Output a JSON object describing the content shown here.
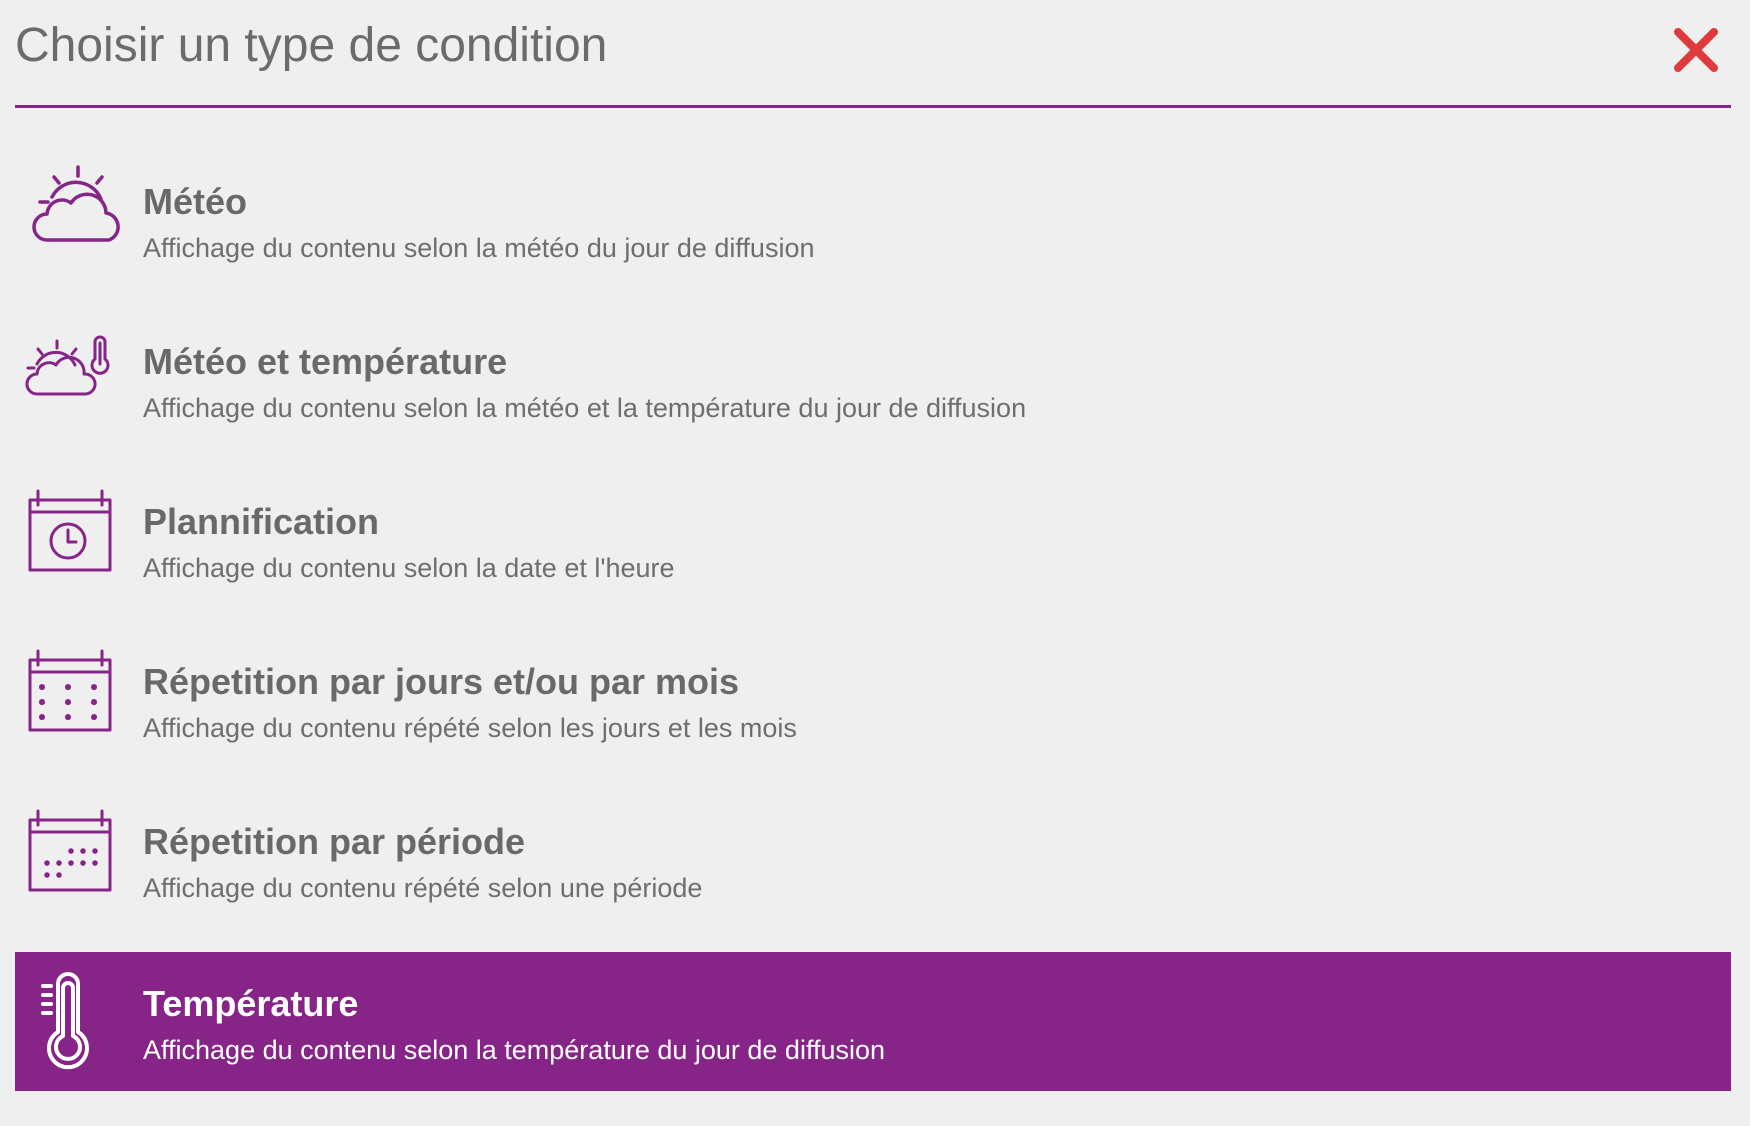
{
  "dialog": {
    "title": "Choisir un type de condition",
    "close_label": "Fermer",
    "accent_color": "#862488",
    "close_color": "#e03a3e"
  },
  "conditions": [
    {
      "name": "Météo",
      "description": "Affichage du contenu selon la météo du jour de diffusion",
      "icon": "weather-icon",
      "selected": false
    },
    {
      "name": "Météo et température",
      "description": "Affichage du contenu selon la météo et la température du jour de diffusion",
      "icon": "weather-thermometer-icon",
      "selected": false
    },
    {
      "name": "Plannification",
      "description": "Affichage du contenu selon la date et l'heure",
      "icon": "calendar-clock-icon",
      "selected": false
    },
    {
      "name": "Répetition par jours et/ou par mois",
      "description": "Affichage du contenu répété selon les jours et les mois",
      "icon": "calendar-grid-icon",
      "selected": false
    },
    {
      "name": "Répetition par période",
      "description": "Affichage du contenu répété selon une période",
      "icon": "calendar-period-icon",
      "selected": false
    },
    {
      "name": "Température",
      "description": "Affichage du contenu selon la température du jour de diffusion",
      "icon": "thermometer-icon",
      "selected": true
    }
  ]
}
